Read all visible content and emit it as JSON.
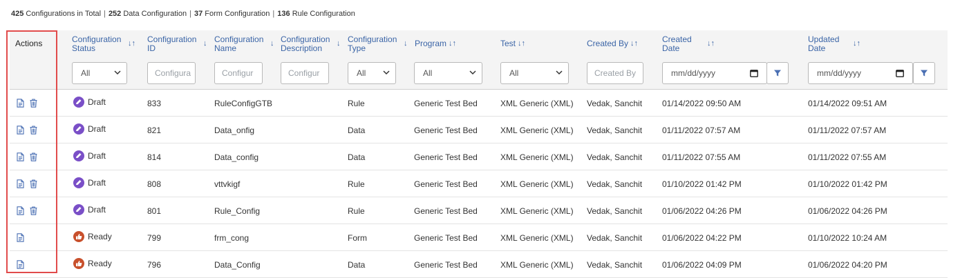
{
  "summary": {
    "total_count": "425",
    "total_label": "Configurations in Total",
    "data_count": "252",
    "data_label": "Data Configuration",
    "form_count": "37",
    "form_label": "Form Configuration",
    "rule_count": "136",
    "rule_label": "Rule Configuration"
  },
  "columns": {
    "actions": "Actions",
    "status": "Configuration Status",
    "id": "Configuration ID",
    "name": "Configuration Name",
    "description": "Configuration Description",
    "type": "Configuration Type",
    "program": "Program",
    "test": "Test",
    "created_by": "Created By",
    "created_date": "Created Date",
    "updated_date": "Updated Date"
  },
  "filters": {
    "status": "All",
    "id_placeholder": "Configura",
    "name_placeholder": "Configur",
    "description_placeholder": "Configur",
    "type": "All",
    "program": "All",
    "test": "All",
    "created_by_placeholder": "Created By",
    "created_date_placeholder": "mm/dd/yyyy",
    "updated_date_placeholder": "mm/dd/yyyy"
  },
  "sort_glyphs": {
    "both": "↓↑",
    "down": "↓"
  },
  "rows": [
    {
      "status": "Draft",
      "id": "833",
      "name": "RuleConfigGTB",
      "type": "Rule",
      "program": "Generic Test Bed",
      "test": "XML Generic (XML)",
      "created_by": "Vedak, Sanchit",
      "created": "01/14/2022 09:50 AM",
      "updated": "01/14/2022 09:51 AM"
    },
    {
      "status": "Draft",
      "id": "821",
      "name": "Data_onfig",
      "type": "Data",
      "program": "Generic Test Bed",
      "test": "XML Generic (XML)",
      "created_by": "Vedak, Sanchit",
      "created": "01/11/2022 07:57 AM",
      "updated": "01/11/2022 07:57 AM"
    },
    {
      "status": "Draft",
      "id": "814",
      "name": "Data_config",
      "type": "Data",
      "program": "Generic Test Bed",
      "test": "XML Generic (XML)",
      "created_by": "Vedak, Sanchit",
      "created": "01/11/2022 07:55 AM",
      "updated": "01/11/2022 07:55 AM"
    },
    {
      "status": "Draft",
      "id": "808",
      "name": "vttvkigf",
      "type": "Rule",
      "program": "Generic Test Bed",
      "test": "XML Generic (XML)",
      "created_by": "Vedak, Sanchit",
      "created": "01/10/2022 01:42 PM",
      "updated": "01/10/2022 01:42 PM"
    },
    {
      "status": "Draft",
      "id": "801",
      "name": "Rule_Config",
      "type": "Rule",
      "program": "Generic Test Bed",
      "test": "XML Generic (XML)",
      "created_by": "Vedak, Sanchit",
      "created": "01/06/2022 04:26 PM",
      "updated": "01/06/2022 04:26 PM"
    },
    {
      "status": "Ready",
      "id": "799",
      "name": "frm_cong",
      "type": "Form",
      "program": "Generic Test Bed",
      "test": "XML Generic (XML)",
      "created_by": "Vedak, Sanchit",
      "created": "01/06/2022 04:22 PM",
      "updated": "01/10/2022 10:24 AM"
    },
    {
      "status": "Ready",
      "id": "796",
      "name": "Data_Config",
      "type": "Data",
      "program": "Generic Test Bed",
      "test": "XML Generic (XML)",
      "created_by": "Vedak, Sanchit",
      "created": "01/06/2022 04:09 PM",
      "updated": "01/06/2022 04:20 PM"
    }
  ],
  "row_actions": {
    "833": [
      "document-icon",
      "trash-icon"
    ],
    "821": [
      "document-icon",
      "trash-icon"
    ],
    "814": [
      "document-icon",
      "trash-icon"
    ],
    "808": [
      "document-icon",
      "trash-icon"
    ],
    "801": [
      "document-icon",
      "trash-icon"
    ],
    "799": [
      "document-icon"
    ],
    "796": [
      "document-icon"
    ]
  },
  "colors": {
    "header_text": "#3a64a6",
    "draft_badge": "#7a4fc7",
    "ready_badge": "#c8502c",
    "highlight_box": "#e14b4b",
    "icon_blue": "#4a6fb3"
  }
}
